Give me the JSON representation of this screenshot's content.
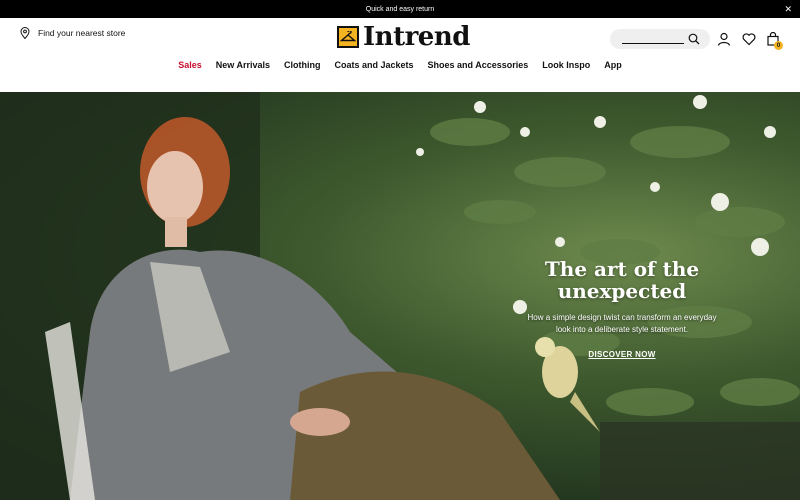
{
  "announcement": {
    "text": "Quick and easy return",
    "close_icon": "close-icon"
  },
  "header": {
    "store_locator": "Find your nearest store",
    "logo_text": "Intrend",
    "search": {
      "placeholder": "",
      "value": ""
    },
    "cart_count": "0",
    "icons": [
      "location-pin-icon",
      "search-icon",
      "account-icon",
      "heart-icon",
      "shopping-bag-icon"
    ]
  },
  "nav": {
    "items": [
      "Sales",
      "New Arrivals",
      "Clothing",
      "Coats and Jackets",
      "Shoes and Accessories",
      "Look Inspo",
      "App"
    ]
  },
  "hero": {
    "title_line1": "The art of the",
    "title_line2": "unexpected",
    "subtitle_line1": "How a simple design twist can transform an everyday",
    "subtitle_line2": "look into a deliberate style statement.",
    "cta": "DISCOVER NOW"
  },
  "colors": {
    "accent": "#f4b321",
    "sale": "#c8102e",
    "topbar": "#000000"
  }
}
